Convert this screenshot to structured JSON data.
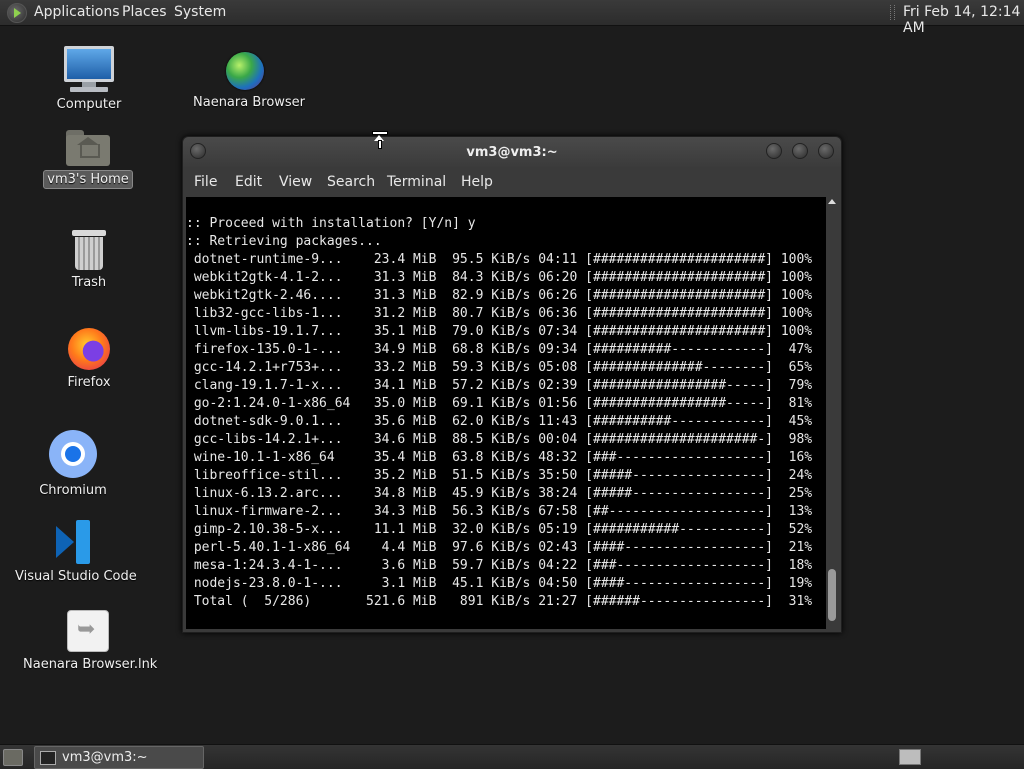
{
  "top_panel": {
    "menus": [
      "Applications",
      "Places",
      "System"
    ],
    "clock": "Fri Feb 14, 12:14 AM"
  },
  "desktop_icons": [
    {
      "label": "Computer",
      "icon": "computer-icon"
    },
    {
      "label": "Naenara Browser",
      "icon": "globe-icon"
    },
    {
      "label": "vm3's Home",
      "icon": "home-folder-icon",
      "selected": true
    },
    {
      "label": "Trash",
      "icon": "trash-icon"
    },
    {
      "label": "Firefox",
      "icon": "firefox-icon"
    },
    {
      "label": "Chromium",
      "icon": "chromium-icon"
    },
    {
      "label": "Visual Studio Code",
      "icon": "vscode-icon"
    },
    {
      "label": "Naenara Browser.lnk",
      "icon": "shortcut-icon"
    }
  ],
  "terminal": {
    "title": "vm3@vm3:~",
    "menu": [
      "File",
      "Edit",
      "View",
      "Search",
      "Terminal",
      "Help"
    ],
    "prompt_lines": [
      ":: Proceed with installation? [Y/n] y",
      ":: Retrieving packages..."
    ],
    "packages": [
      {
        "name": "dotnet-runtime-9...",
        "size": "23.4 MiB",
        "speed": "95.5 KiB/s",
        "time": "04:11",
        "bar": "[######################]",
        "percent": "100%"
      },
      {
        "name": "webkit2gtk-4.1-2...",
        "size": "31.3 MiB",
        "speed": "84.3 KiB/s",
        "time": "06:20",
        "bar": "[######################]",
        "percent": "100%"
      },
      {
        "name": "webkit2gtk-2.46....",
        "size": "31.3 MiB",
        "speed": "82.9 KiB/s",
        "time": "06:26",
        "bar": "[######################]",
        "percent": "100%"
      },
      {
        "name": "lib32-gcc-libs-1...",
        "size": "31.2 MiB",
        "speed": "80.7 KiB/s",
        "time": "06:36",
        "bar": "[######################]",
        "percent": "100%"
      },
      {
        "name": "llvm-libs-19.1.7...",
        "size": "35.1 MiB",
        "speed": "79.0 KiB/s",
        "time": "07:34",
        "bar": "[######################]",
        "percent": "100%"
      },
      {
        "name": "firefox-135.0-1-...",
        "size": "34.9 MiB",
        "speed": "68.8 KiB/s",
        "time": "09:34",
        "bar": "[##########------------]",
        "percent": "47%"
      },
      {
        "name": "gcc-14.2.1+r753+...",
        "size": "33.2 MiB",
        "speed": "59.3 KiB/s",
        "time": "05:08",
        "bar": "[##############--------]",
        "percent": "65%"
      },
      {
        "name": "clang-19.1.7-1-x...",
        "size": "34.1 MiB",
        "speed": "57.2 KiB/s",
        "time": "02:39",
        "bar": "[#################-----]",
        "percent": "79%"
      },
      {
        "name": "go-2:1.24.0-1-x86_64",
        "size": "35.0 MiB",
        "speed": "69.1 KiB/s",
        "time": "01:56",
        "bar": "[#################-----]",
        "percent": "81%"
      },
      {
        "name": "dotnet-sdk-9.0.1...",
        "size": "35.6 MiB",
        "speed": "62.0 KiB/s",
        "time": "11:43",
        "bar": "[##########------------]",
        "percent": "45%"
      },
      {
        "name": "gcc-libs-14.2.1+...",
        "size": "34.6 MiB",
        "speed": "88.5 KiB/s",
        "time": "00:04",
        "bar": "[#####################-]",
        "percent": "98%"
      },
      {
        "name": "wine-10.1-1-x86_64",
        "size": "35.4 MiB",
        "speed": "63.8 KiB/s",
        "time": "48:32",
        "bar": "[###-------------------]",
        "percent": "16%"
      },
      {
        "name": "libreoffice-stil...",
        "size": "35.2 MiB",
        "speed": "51.5 KiB/s",
        "time": "35:50",
        "bar": "[#####-----------------]",
        "percent": "24%"
      },
      {
        "name": "linux-6.13.2.arc...",
        "size": "34.8 MiB",
        "speed": "45.9 KiB/s",
        "time": "38:24",
        "bar": "[#####-----------------]",
        "percent": "25%"
      },
      {
        "name": "linux-firmware-2...",
        "size": "34.3 MiB",
        "speed": "56.3 KiB/s",
        "time": "67:58",
        "bar": "[##--------------------]",
        "percent": "13%"
      },
      {
        "name": "gimp-2.10.38-5-x...",
        "size": "11.1 MiB",
        "speed": "32.0 KiB/s",
        "time": "05:19",
        "bar": "[###########-----------]",
        "percent": "52%"
      },
      {
        "name": "perl-5.40.1-1-x86_64",
        "size": "4.4 MiB",
        "speed": "97.6 KiB/s",
        "time": "02:43",
        "bar": "[####------------------]",
        "percent": "21%"
      },
      {
        "name": "mesa-1:24.3.4-1-...",
        "size": "3.6 MiB",
        "speed": "59.7 KiB/s",
        "time": "04:22",
        "bar": "[###-------------------]",
        "percent": "18%"
      },
      {
        "name": "nodejs-23.8.0-1-...",
        "size": "3.1 MiB",
        "speed": "45.1 KiB/s",
        "time": "04:50",
        "bar": "[####------------------]",
        "percent": "19%"
      }
    ],
    "total": {
      "name": "Total (  5/286)",
      "size": "521.6 MiB",
      "speed": "891 KiB/s",
      "time": "21:27",
      "bar": "[######----------------]",
      "percent": "31%"
    }
  },
  "bottom_panel": {
    "task_label": "vm3@vm3:~"
  }
}
